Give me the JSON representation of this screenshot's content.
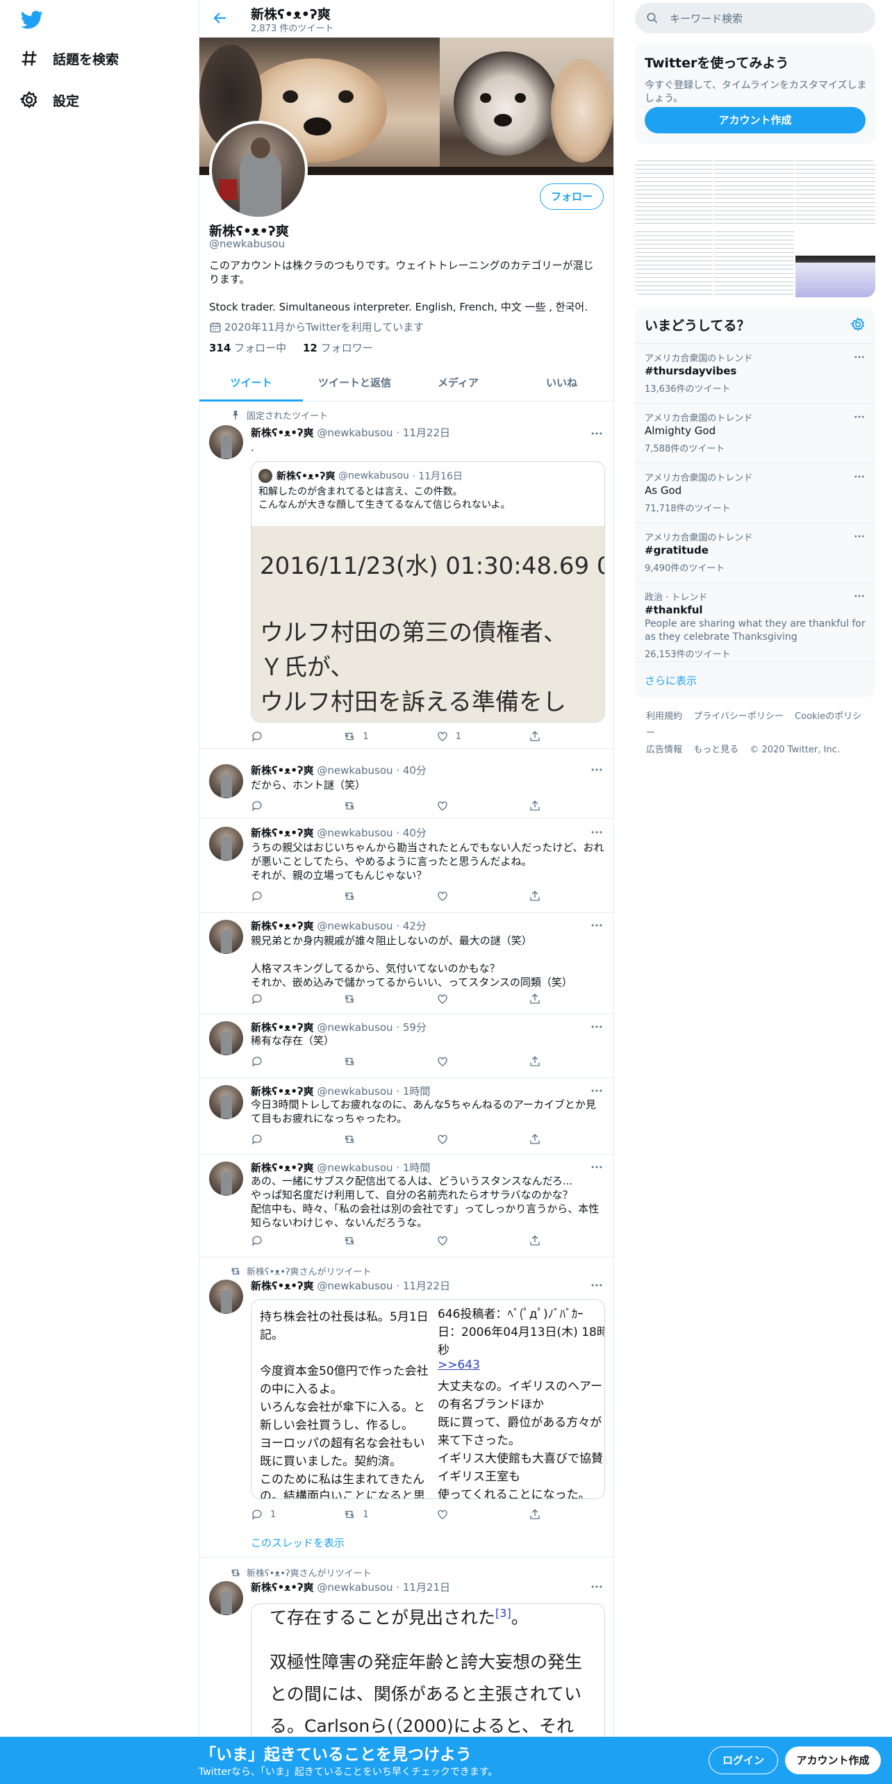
{
  "nav": {
    "items": [
      {
        "label": "話題を検索",
        "icon": "hashtag-icon"
      },
      {
        "label": "設定",
        "icon": "gear-icon"
      }
    ]
  },
  "header": {
    "name": "新株ʕ•ᴥ•ʔ爽",
    "tweet_count": "2,873 件のツイート"
  },
  "profile": {
    "name": "新株ʕ•ᴥ•ʔ爽",
    "handle": "@newkabusou",
    "follow_label": "フォロー",
    "bio1": "このアカウントは株クラのつもりです。ウェイトトレーニングのカテゴリーが混じります。",
    "bio2": "Stock trader. Simultaneous interpreter. English, French, 中文 一些 , 한국어.",
    "joined": "2020年11月からTwitterを利用しています",
    "following_count": "314",
    "following_label": "フォロー中",
    "followers_count": "12",
    "followers_label": "フォロワー"
  },
  "tabs": [
    "ツイート",
    "ツイートと返信",
    "メディア",
    "いいね"
  ],
  "tweets": [
    {
      "context": "固定されたツイート",
      "name": "新株ʕ•ᴥ•ʔ爽",
      "handle": "@newkabusou",
      "time": "· 11月22日",
      "text": ".",
      "quote": {
        "name": "新株ʕ•ᴥ•ʔ爽",
        "handle": "@newkabusou",
        "time": "· 11月16日",
        "text": "和解したのが含まれてるとは言え、この件数。\nこんなんが大きな顔して生きてるなんて信じられないよ。",
        "image_lines": [
          "2016/11/23(水) 01:30:48.69 0",
          "ウルフ村田の第三の債権者、",
          "Ｙ氏が、",
          "ウルフ村田を訴える準備をし"
        ]
      },
      "replies": "",
      "retweets": "1",
      "likes": "1"
    },
    {
      "name": "新株ʕ•ᴥ•ʔ爽",
      "handle": "@newkabusou",
      "time": "· 40分",
      "text": "だから、ホント謎（笑）"
    },
    {
      "name": "新株ʕ•ᴥ•ʔ爽",
      "handle": "@newkabusou",
      "time": "· 40分",
      "text": "うちの親父はおじいちゃんから勘当されたとんでもない人だったけど、おれが悪いことしてたら、やめるように言ったと思うんだよね。\nそれが、親の立場ってもんじゃない？"
    },
    {
      "name": "新株ʕ•ᴥ•ʔ爽",
      "handle": "@newkabusou",
      "time": "· 42分",
      "text": "親兄弟とか身内親戚が誰々阻止しないのが、最大の謎（笑）\n\n人格マスキングしてるから、気付いてないのかもな？\nそれか、嵌め込みで儲かってるからいい、ってスタンスの同類（笑）"
    },
    {
      "name": "新株ʕ•ᴥ•ʔ爽",
      "handle": "@newkabusou",
      "time": "· 59分",
      "text": "稀有な存在（笑）"
    },
    {
      "name": "新株ʕ•ᴥ•ʔ爽",
      "handle": "@newkabusou",
      "time": "· 1時間",
      "text": "今日3時間トレしてお疲れなのに、あんな5ちゃんねるのアーカイブとか見て目もお疲れになっちゃったわ。"
    },
    {
      "name": "新株ʕ•ᴥ•ʔ爽",
      "handle": "@newkabusou",
      "time": "· 1時間",
      "text": "あの、一緒にサブスク配信出てる人は、どういうスタンスなんだろ...\nやっぱ知名度だけ利用して、自分の名前売れたらオサラバなのかな？\n配信中も、時々、「私の会社は別の会社です」ってしっかり言うから、本性知らないわけじゃ、ないんだろうな。"
    },
    {
      "context": "新株ʕ•ᴥ•ʔ爽さんがリツイート",
      "name": "新株ʕ•ᴥ•ʔ爽",
      "handle": "@newkabusou",
      "time": "· 11月22日",
      "left_lines": [
        "持ち株会社の社長は私。5月1日",
        "記。",
        "",
        "今度資本金50億円で作った会社",
        "の中に入るよ。",
        "いろんな会社が傘下に入る。と",
        "新しい会社買うし、作るし。",
        "ヨーロッパの超有名な会社もい",
        "既に買いました。契約済。",
        "このために私は生まれてきたん",
        "の。結構面白いことになると思"
      ],
      "right_lines": [
        "646投稿者：ﾍﾞ(ﾟдﾟ)ﾉﾞﾊﾞｶｰ",
        "日：2006年04月13日(木) 18時",
        "秒",
        ">>643",
        "大丈夫なの。イギリスのヘアー",
        "の有名ブランドほか",
        "既に買って、爵位がある方々が",
        "来て下さった。",
        "イギリス大使館も大喜びで協賛",
        "イギリス王室も",
        "使ってくれることになった。"
      ],
      "replies": "1",
      "retweets": "1",
      "likes": "",
      "thread_label": "このスレッドを表示"
    },
    {
      "context": "新株ʕ•ᴥ•ʔ爽さんがリツイート",
      "name": "新株ʕ•ᴥ•ʔ爽",
      "handle": "@newkabusou",
      "time": "· 11月21日",
      "lines": [
        "て存在することが見出された",
        "",
        "双極性障害の発症年齢と誇大妄想の発生",
        "との間には、関係があると主張されてい",
        "る。Carlsonら(（2000)によると、それ"
      ],
      "sup": "[3]",
      "tail": "。"
    }
  ],
  "search": {
    "placeholder": "キーワード検索"
  },
  "signup": {
    "title": "Twitterを使ってみよう",
    "subtitle": "今すぐ登録して、タイムラインをカスタマイズしましょう。",
    "button": "アカウント作成"
  },
  "trends": {
    "title": "いまどうしてる？",
    "items": [
      {
        "context": "アメリカ合衆国のトレンド",
        "topic": "#thursdayvibes",
        "count": "13,636件のツイート"
      },
      {
        "context": "アメリカ合衆国のトレンド",
        "topic": "Almighty God",
        "count": "7,588件のツイート"
      },
      {
        "context": "アメリカ合衆国のトレンド",
        "topic": "As God",
        "count": "71,718件のツイート"
      },
      {
        "context": "アメリカ合衆国のトレンド",
        "topic": "#gratitude",
        "count": "9,490件のツイート"
      },
      {
        "context": "政治 · トレンド",
        "topic": "#thankful",
        "desc": "People are sharing what they are thankful for as they celebrate Thanksgiving",
        "count": "26,153件のツイート"
      }
    ],
    "show_more": "さらに表示"
  },
  "footer": {
    "terms": "利用規約",
    "privacy": "プライバシーポリシー",
    "cookie": "Cookieのポリシー",
    "ads": "広告情報",
    "more": "もっと見る",
    "copyright": "© 2020 Twitter, Inc."
  },
  "bottombar": {
    "title": "「いま」起きていることを見つけよう",
    "subtitle": "Twitterなら、「いま」起きていることをいち早くチェックできます。",
    "login": "ログイン",
    "signup": "アカウント作成"
  },
  "colors": {
    "accent": "#1da1f2",
    "text": "#0f1419",
    "secondary": "#5b7083"
  }
}
